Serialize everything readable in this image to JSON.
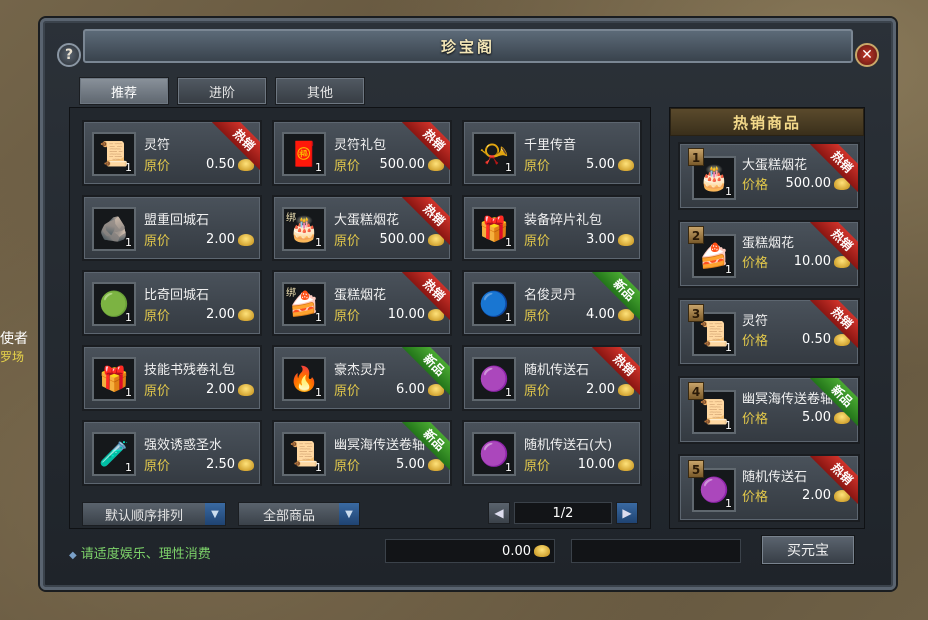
{
  "window": {
    "title": "珍宝阁"
  },
  "background": {
    "side_name": "使者",
    "side_sub": "罗场"
  },
  "tabs": [
    {
      "label": "推荐",
      "active": true
    },
    {
      "label": "进阶",
      "active": false
    },
    {
      "label": "其他",
      "active": false
    }
  ],
  "items": [
    {
      "name": "灵符",
      "price_label": "原价",
      "price": "0.50",
      "qty": "1",
      "badge": "热销",
      "icon": "talisman-icon",
      "glyph": "📜",
      "bind": ""
    },
    {
      "name": "灵符礼包",
      "price_label": "原价",
      "price": "500.00",
      "qty": "1",
      "badge": "热销",
      "icon": "talisman-pack-icon",
      "glyph": "🧧",
      "bind": ""
    },
    {
      "name": "千里传音",
      "price_label": "原价",
      "price": "5.00",
      "qty": "1",
      "badge": "",
      "icon": "horn-icon",
      "glyph": "📯",
      "bind": ""
    },
    {
      "name": "盟重回城石",
      "price_label": "原价",
      "price": "2.00",
      "qty": "1",
      "badge": "",
      "icon": "return-stone-icon",
      "glyph": "🪨",
      "bind": ""
    },
    {
      "name": "大蛋糕烟花",
      "price_label": "原价",
      "price": "500.00",
      "qty": "1",
      "badge": "热销",
      "icon": "big-cake-firework-icon",
      "glyph": "🎂",
      "bind": "绑"
    },
    {
      "name": "装备碎片礼包",
      "price_label": "原价",
      "price": "3.00",
      "qty": "1",
      "badge": "",
      "icon": "gift-box-icon",
      "glyph": "🎁",
      "bind": ""
    },
    {
      "name": "比奇回城石",
      "price_label": "原价",
      "price": "2.00",
      "qty": "1",
      "badge": "",
      "icon": "green-stone-icon",
      "glyph": "🟢",
      "bind": ""
    },
    {
      "name": "蛋糕烟花",
      "price_label": "原价",
      "price": "10.00",
      "qty": "1",
      "badge": "热销",
      "icon": "cake-firework-icon",
      "glyph": "🍰",
      "bind": "绑"
    },
    {
      "name": "名俊灵丹",
      "price_label": "原价",
      "price": "4.00",
      "qty": "1",
      "badge": "新品",
      "icon": "blue-pill-icon",
      "glyph": "🔵",
      "bind": ""
    },
    {
      "name": "技能书残卷礼包",
      "price_label": "原价",
      "price": "2.00",
      "qty": "1",
      "badge": "",
      "icon": "skill-book-pack-icon",
      "glyph": "🎁",
      "bind": ""
    },
    {
      "name": "豪杰灵丹",
      "price_label": "原价",
      "price": "6.00",
      "qty": "1",
      "badge": "新品",
      "icon": "fire-pill-icon",
      "glyph": "🔥",
      "bind": ""
    },
    {
      "name": "随机传送石",
      "price_label": "原价",
      "price": "2.00",
      "qty": "1",
      "badge": "热销",
      "icon": "purple-stone-icon",
      "glyph": "🟣",
      "bind": ""
    },
    {
      "name": "强效诱惑圣水",
      "price_label": "原价",
      "price": "2.50",
      "qty": "1",
      "badge": "",
      "icon": "potion-icon",
      "glyph": "🧪",
      "bind": ""
    },
    {
      "name": "幽冥海传送卷轴",
      "price_label": "原价",
      "price": "5.00",
      "qty": "1",
      "badge": "新品",
      "icon": "scroll-icon",
      "glyph": "📜",
      "bind": ""
    },
    {
      "name": "随机传送石(大)",
      "price_label": "原价",
      "price": "10.00",
      "qty": "1",
      "badge": "",
      "icon": "purple-stone-icon",
      "glyph": "🟣",
      "bind": ""
    }
  ],
  "controls": {
    "sort_label": "默认顺序排列",
    "filter_label": "全部商品",
    "page": "1/2",
    "prev_arrow": "◀",
    "next_arrow": "▶",
    "dropdown_arrow": "▼"
  },
  "hot": {
    "title": "热销商品",
    "items": [
      {
        "rank": "1",
        "name": "大蛋糕烟花",
        "price_label": "价格",
        "price": "500.00",
        "qty": "1",
        "badge": "热销",
        "icon": "big-cake-firework-icon",
        "glyph": "🎂"
      },
      {
        "rank": "2",
        "name": "蛋糕烟花",
        "price_label": "价格",
        "price": "10.00",
        "qty": "1",
        "badge": "热销",
        "icon": "cake-firework-icon",
        "glyph": "🍰"
      },
      {
        "rank": "3",
        "name": "灵符",
        "price_label": "价格",
        "price": "0.50",
        "qty": "1",
        "badge": "热销",
        "icon": "talisman-icon",
        "glyph": "📜"
      },
      {
        "rank": "4",
        "name": "幽冥海传送卷轴",
        "price_label": "价格",
        "price": "5.00",
        "qty": "1",
        "badge": "新品",
        "icon": "scroll-icon",
        "glyph": "📜"
      },
      {
        "rank": "5",
        "name": "随机传送石",
        "price_label": "价格",
        "price": "2.00",
        "qty": "1",
        "badge": "热销",
        "icon": "purple-stone-icon",
        "glyph": "🟣"
      }
    ]
  },
  "footer": {
    "tip": "请适度娱乐、理性消费",
    "balance": "0.00",
    "buy_label": "买元宝"
  },
  "colors": {
    "hot_badge": "#d0322a",
    "new_badge": "#4aaa32",
    "price_label": "#e2c84a",
    "tip": "#7dd36a"
  }
}
